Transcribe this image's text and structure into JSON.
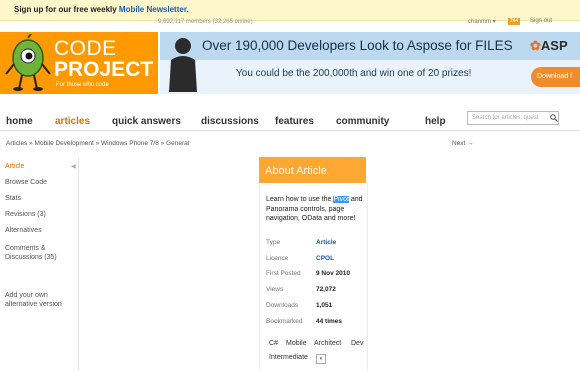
{
  "top_bar": {
    "prefix": "Sign up for our free weekly",
    "link": "Mobile Newsletter",
    "suffix": "."
  },
  "members": "9,692,117 members (32,265 online)",
  "user": {
    "name": "chanmm ▾",
    "reputation": "244",
    "signout": "Sign out"
  },
  "logo": {
    "line1": "CODE",
    "line2": "PROJECT",
    "tagline": "For those who code"
  },
  "banner": {
    "headline": "Over 190,000 Developers Look to Aspose for FILES",
    "sub": "You could be the 200,000th and win one of 20 prizes!",
    "brand": "ASP",
    "button": "Download f",
    "accent": "#f28b2c"
  },
  "nav": {
    "items": [
      "home",
      "articles",
      "quick answers",
      "discussions",
      "features",
      "community",
      "help"
    ],
    "search_placeholder": "Search for articles, quest"
  },
  "breadcrumb": "Articles » Mobile Development » Windows Phone 7/8 » General",
  "next": "Next →",
  "sidebar": {
    "items": [
      "Article",
      "Browse Code",
      "Stats",
      "Revisions (3)",
      "Alternatives",
      "Comments &",
      "Discussions (35)",
      "Add your own",
      "alternative version"
    ]
  },
  "about": {
    "title": "About Article",
    "desc_before": "Learn how to use the",
    "desc_highlight": "Pivot",
    "desc_after": "and Panorama controls, page navigation, OData and more!",
    "rows": [
      {
        "label": "Type",
        "value": "Article"
      },
      {
        "label": "Licence",
        "value": "CPOL"
      },
      {
        "label": "First Posted",
        "value": "9 Nov 2010"
      },
      {
        "label": "Views",
        "value": "72,072"
      },
      {
        "label": "Downloads",
        "value": "1,051"
      },
      {
        "label": "Bookmarked",
        "value": "44 times"
      }
    ],
    "tags": [
      "C#",
      "Mobile",
      "Architect",
      "Dev"
    ],
    "level": "Intermediate",
    "level_dropdown": "▾",
    "header_color": "#ffa733"
  }
}
